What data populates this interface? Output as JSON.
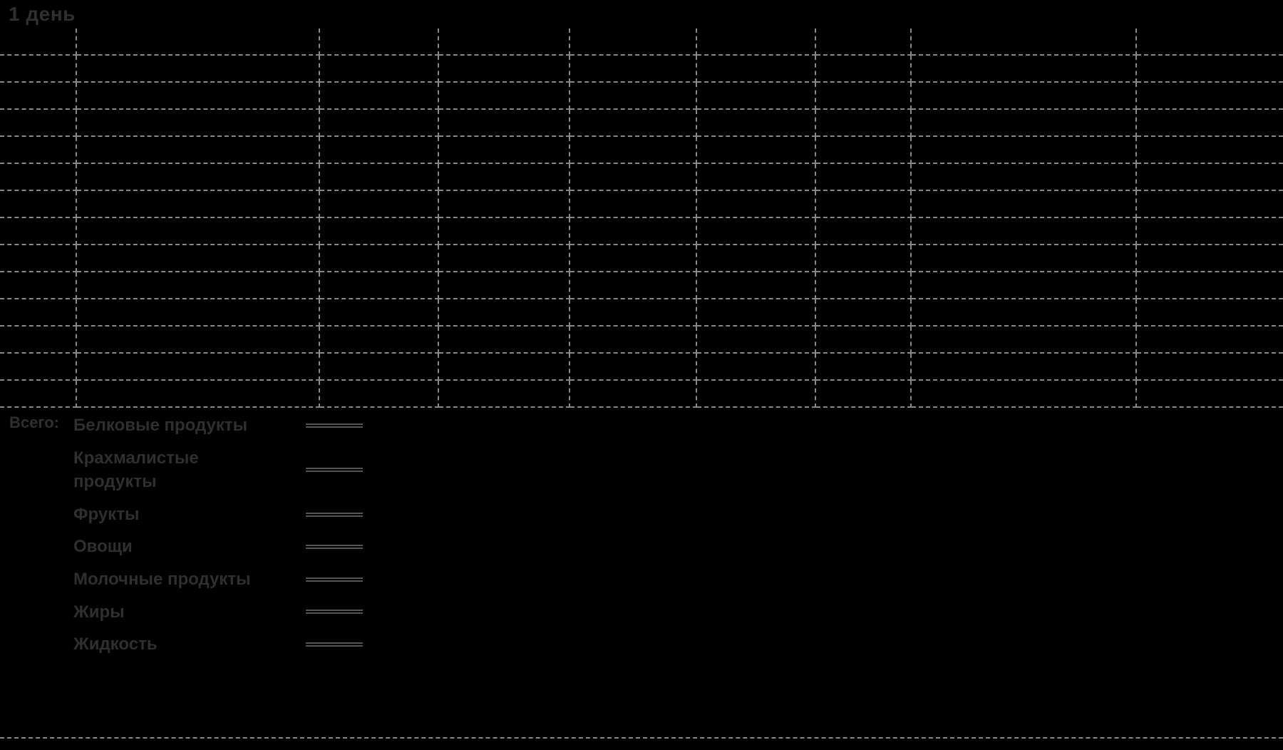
{
  "title": "1 день",
  "grid": {
    "rows": 14,
    "cols": 9
  },
  "totals": {
    "label": "Всего:",
    "categories": [
      "Белковые продукты",
      "Крахмалистые продукты",
      "Фрукты",
      "Овощи",
      "Молочные продукты",
      "Жиры",
      "Жидкость"
    ]
  }
}
